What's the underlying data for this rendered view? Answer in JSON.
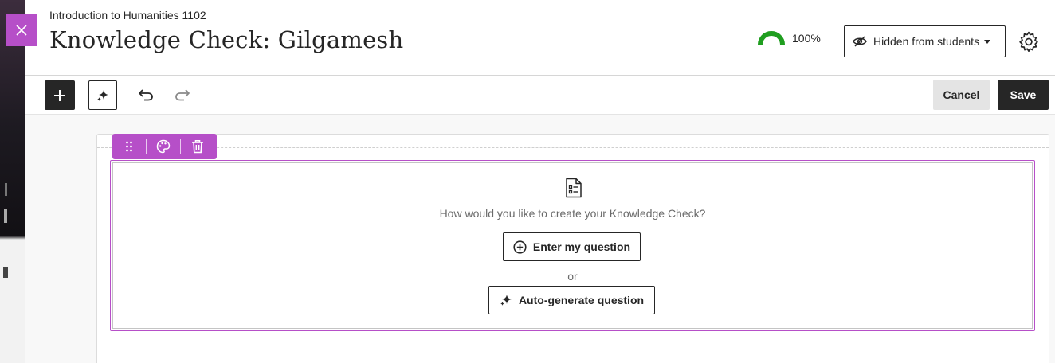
{
  "header": {
    "course_name": "Introduction to Humanities 1102",
    "page_title": "Knowledge Check: Gilgamesh",
    "progress_percent": 100,
    "progress_label": "100%",
    "visibility_label": "Hidden from students"
  },
  "toolbar": {
    "cancel_label": "Cancel",
    "save_label": "Save"
  },
  "block": {
    "prompt": "How would you like to create your Knowledge Check?",
    "enter_question_label": "Enter my question",
    "or_label": "or",
    "auto_generate_label": "Auto-generate question"
  },
  "icons": {
    "close": "close-icon",
    "add": "plus-icon",
    "ai": "sparkle-icon",
    "undo": "undo-icon",
    "redo": "redo-icon",
    "visibility": "eye-off-icon",
    "settings": "gear-icon",
    "drag": "drag-handle-icon",
    "palette": "palette-icon",
    "delete": "trash-icon",
    "document": "document-icon",
    "add_circle": "plus-circle-icon"
  },
  "colors": {
    "accent": "#b64fc8",
    "progress": "#1f9e1f",
    "dark": "#262626",
    "muted_text": "#6a6a6a"
  }
}
